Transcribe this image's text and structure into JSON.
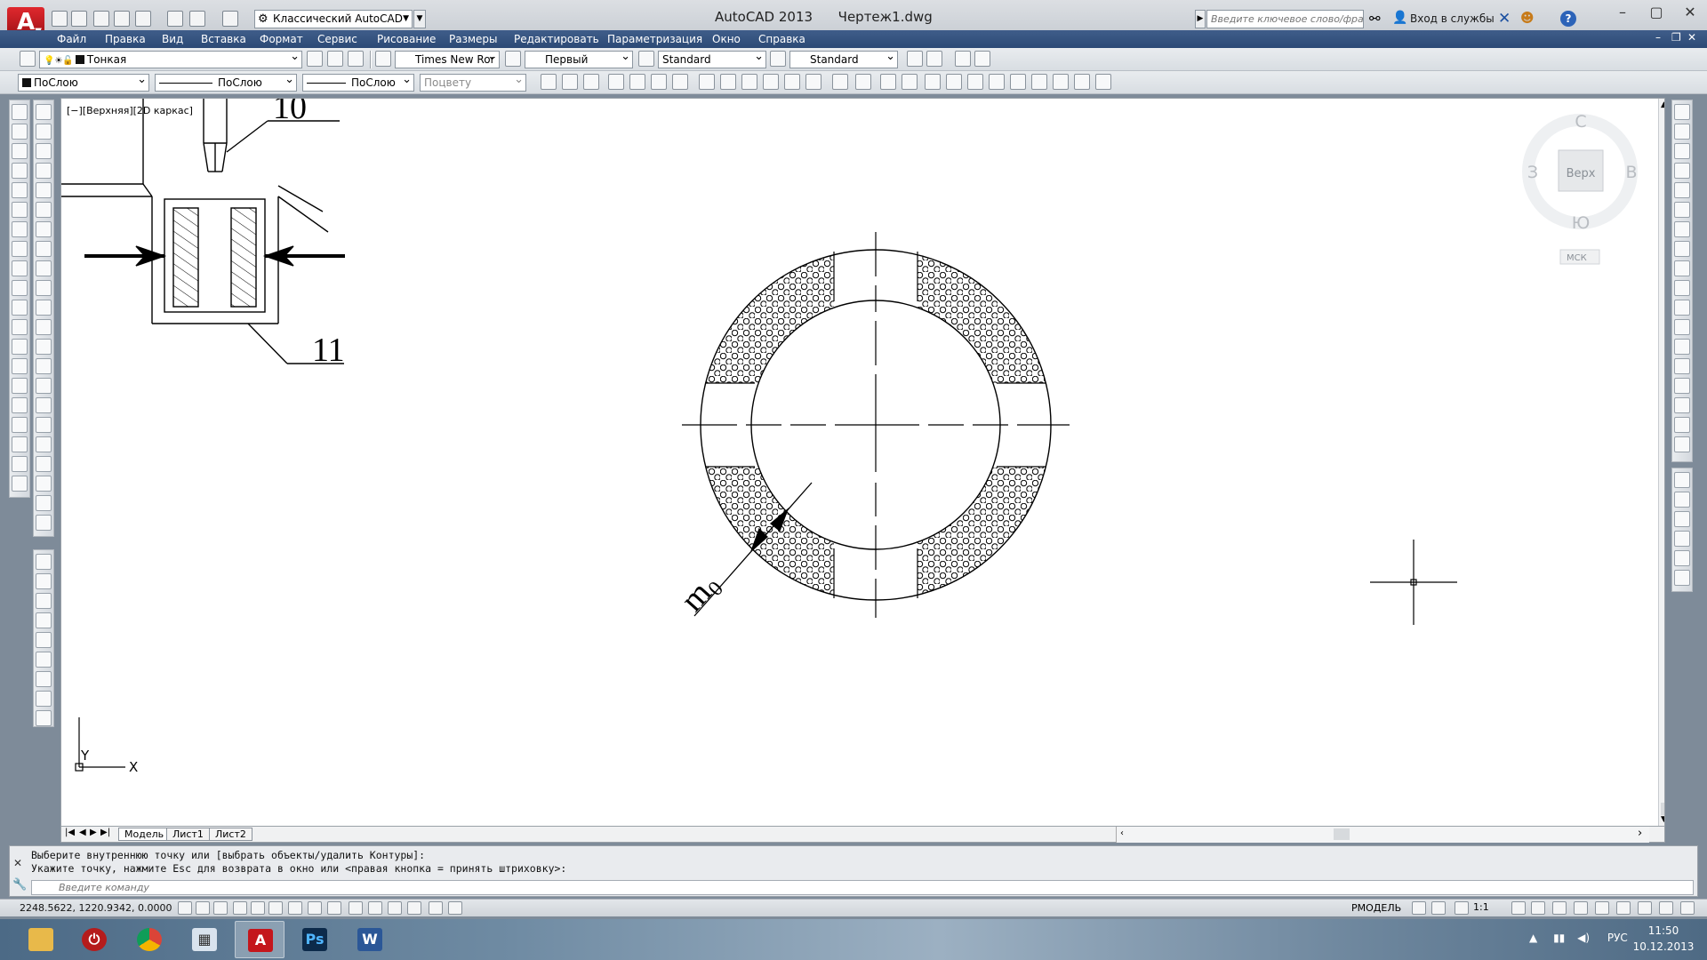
{
  "title_bar": {
    "workspace": "Классический AutoCAD",
    "title": "AutoCAD 2013      Чертеж1.dwg",
    "search_placeholder": "Введите ключевое слово/фразу",
    "sign_in": "Вход в службы"
  },
  "menu": [
    "Файл",
    "Правка",
    "Вид",
    "Вставка",
    "Формат",
    "Сервис",
    "Рисование",
    "Размеры",
    "Редактировать",
    "Параметризация",
    "Окно",
    "Справка"
  ],
  "toolbar1": {
    "layer": "Тонкая",
    "font": "Times New Ror",
    "dim_style": "Первый",
    "text_style": "Standard",
    "table_style": "Standard"
  },
  "toolbar2": {
    "color": "ПоСлою",
    "linetype": "ПоСлою",
    "lineweight": "ПоСлою",
    "plot_style": "Поцвету"
  },
  "viewport": {
    "label": "[−][Верхняя][2D каркас]",
    "callouts": [
      "10",
      "11"
    ],
    "dim_text": "m",
    "dim_sub": "0"
  },
  "viewcube": {
    "north": "С",
    "south": "Ю",
    "west": "З",
    "east": "В",
    "face": "Верх",
    "ucs": "МСК"
  },
  "ucs_icon": {
    "x": "X",
    "y": "Y"
  },
  "tabs": [
    "Модель",
    "Лист1",
    "Лист2"
  ],
  "command": {
    "line1": "Выберите внутреннюю точку или [выбрать объекты/удалить Контуры]:",
    "line2": "Укажите точку, нажмите Esc для возврата в окно или <правая кнопка = принять штриховку>:",
    "placeholder": "Введите команду"
  },
  "status": {
    "coords": "2248.5622, 1220.9342, 0.0000",
    "space": "РМОДЕЛЬ",
    "scale": "1:1"
  },
  "taskbar": {
    "lang": "РУС",
    "time": "11:50",
    "date": "10.12.2013",
    "apps": [
      "file-explorer",
      "power",
      "chrome",
      "calculator",
      "autocad",
      "photoshop",
      "word"
    ]
  },
  "colors": {
    "menubar": "#2c4a76",
    "autocad_red": "#c4161c",
    "photoshop_blue": "#0c2a4a",
    "word_blue": "#2b5797"
  }
}
